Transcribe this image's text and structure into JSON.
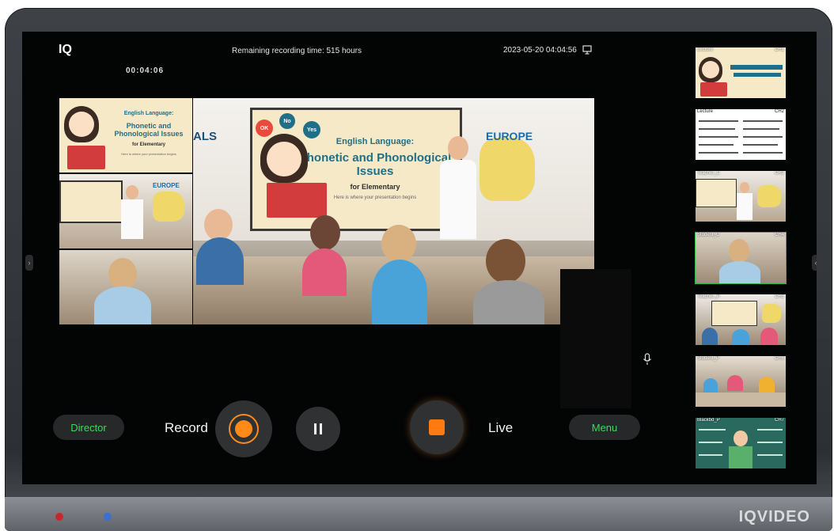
{
  "header": {
    "logo": "IQ",
    "remaining": "Remaining recording time: 515 hours",
    "datetime": "2023-05-20 04:04:56",
    "timer": "00:04:06"
  },
  "main_view": {
    "board_title": "English Language:",
    "board_title2": "Phonetic and Phonological Issues",
    "board_sub": "for Elementary",
    "board_tagline": "Here is where your presentation begins",
    "map_label": "EUROPE",
    "left_text": "ALS",
    "bubbles": [
      "OK",
      "No",
      "Yes"
    ]
  },
  "pip": {
    "slide_title": "English Language:",
    "slide_title2": "Phonetic and Phonological Issues",
    "slide_sub": "for Elementary",
    "slide_tagline": "Here is where your presentation begins",
    "map_label": "EUROPE"
  },
  "thumbnails": [
    {
      "label": "Lecture",
      "ch": "CH1"
    },
    {
      "label": "Lecture",
      "ch": "CH2"
    },
    {
      "label": "Teacher_C",
      "ch": "CH3"
    },
    {
      "label": "Student_C",
      "ch": "CH4"
    },
    {
      "label": "Teacher_P",
      "ch": "CH5"
    },
    {
      "label": "Student_P",
      "ch": "CH6"
    },
    {
      "label": "Blackbd_P",
      "ch": "CH7"
    }
  ],
  "controls": {
    "director": "Director",
    "record": "Record",
    "live": "Live",
    "menu": "Menu"
  },
  "device": {
    "brand": "IQVIDEO"
  },
  "colors": {
    "accent_green": "#3cdc5a",
    "record_orange": "#ff8a1a",
    "live_orange": "#ff7a10",
    "selected_border": "#2db84a"
  },
  "icons": {
    "display": "monitor-icon",
    "mic": "microphone-icon",
    "pause": "pause-icon",
    "stop": "stop-icon"
  }
}
